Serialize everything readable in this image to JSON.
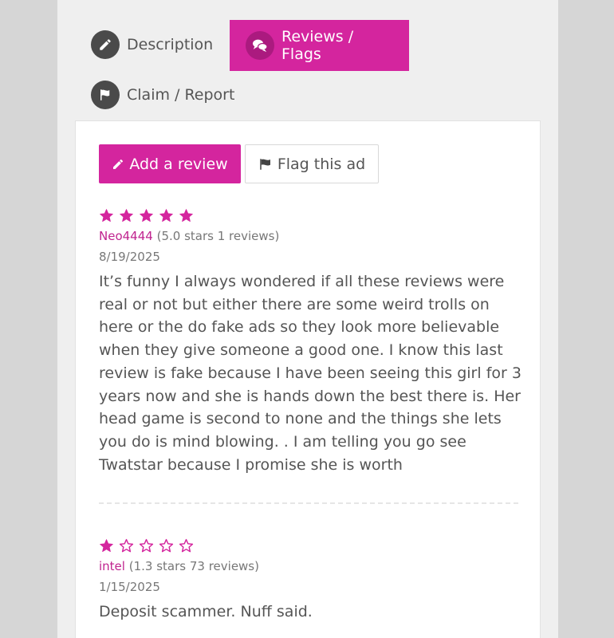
{
  "tabs": {
    "description": {
      "label": "Description",
      "icon": "pencil-icon"
    },
    "reviews": {
      "label": "Reviews / Flags",
      "icon": "speech-bubbles-icon"
    },
    "claim": {
      "label": "Claim / Report",
      "icon": "flag-icon"
    }
  },
  "actions": {
    "add_review": "Add a review",
    "flag_ad": "Flag this ad"
  },
  "colors": {
    "accent": "#d4259e",
    "icon_bg": "#4a4a4a",
    "text": "#555555"
  },
  "reviews": [
    {
      "rating": 5,
      "author": "Neo4444",
      "author_stats": "(5.0 stars 1 reviews)",
      "date": "8/19/2025",
      "text": "It’s funny I always wondered if all these reviews were real or not but either there are some weird trolls on here or the do fake ads so they look more believable when they give someone a good one. I know this last review is fake because I have been seeing this girl for 3 years now and she is hands down the best there is. Her head game is second to none and the things she lets you do is mind blowing. . I am telling you go see Twatstar because I promise she is worth"
    },
    {
      "rating": 1,
      "author": "intel",
      "author_stats": "(1.3 stars 73 reviews)",
      "date": "1/15/2025",
      "text": "Deposit scammer. Nuff said."
    }
  ]
}
